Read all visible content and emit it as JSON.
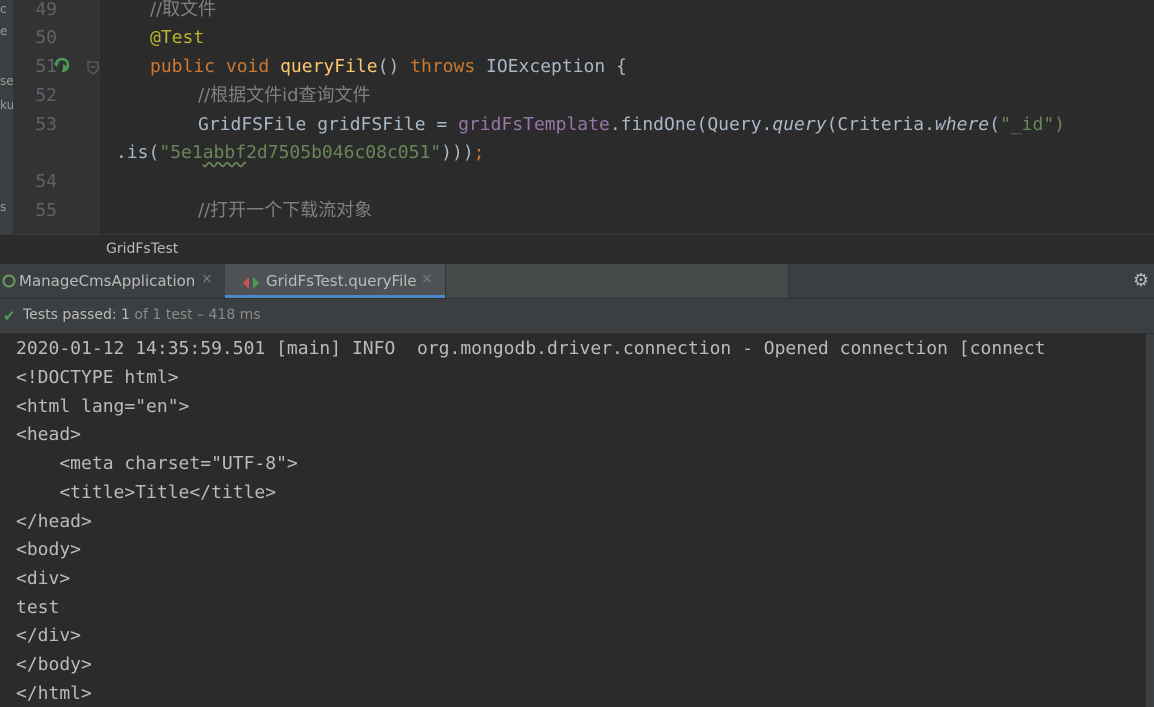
{
  "editor": {
    "left_strip_chars": [
      "c",
      "e",
      "se",
      "ku",
      "s"
    ],
    "lines": [
      {
        "no": "49",
        "text": "//取文件"
      },
      {
        "no": "50",
        "text": "@Test"
      },
      {
        "no": "51",
        "kw1": "public",
        "kw2": "void",
        "fn": "queryFile",
        "paren": "() ",
        "kw3": "throws",
        "rest": " IOException {"
      },
      {
        "no": "52",
        "text": "//根据文件id查询文件"
      },
      {
        "no": "53",
        "p1": "GridFSFile gridFSFile = ",
        "field": "gridFsTemplate",
        "p2": ".findOne(Query.",
        "m1": "query",
        "p3": "(Criteria.",
        "m2": "where",
        "p4": "(",
        "s1": "\"_id\")"
      },
      {
        "cont_p1": ".is(",
        "cont_str_q": "\"",
        "cont_str_a": "5e1",
        "cont_str_b": "abbf",
        "cont_str_c": "2d7505b046c08c051\"",
        "cont_p2": ")))",
        "cont_semi": ";"
      },
      {
        "no": "54",
        "text": ""
      },
      {
        "no": "55",
        "text": "//打开一个下载流对象"
      }
    ]
  },
  "breadcrumb": "GridFsTest",
  "run_tabs": [
    {
      "label": "ManageCmsApplication",
      "close": "×"
    },
    {
      "label": "GridFsTest.queryFile",
      "close": "×"
    }
  ],
  "gear_icon_glyph": "⚙",
  "status": {
    "check_glyph": "✔",
    "prefix": "Tests passed: ",
    "count": "1",
    "suffix": " of 1 test – 418 ms"
  },
  "console_lines": [
    "2020-01-12 14:35:59.501 [main] INFO  org.mongodb.driver.connection - Opened connection [connect",
    "<!DOCTYPE html>",
    "<html lang=\"en\">",
    "<head>",
    "    <meta charset=\"UTF-8\">",
    "    <title>Title</title>",
    "</head>",
    "<body>",
    "<div>",
    "test",
    "</div>",
    "</body>",
    "</html>"
  ]
}
